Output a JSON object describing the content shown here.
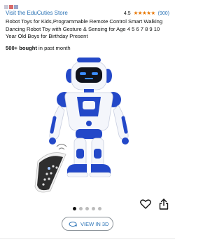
{
  "store": {
    "link_label": "Visit the EduCuties Store"
  },
  "rating": {
    "value": "4.5",
    "stars": "★★★★★",
    "count": "(900)",
    "score": 4.5
  },
  "product": {
    "title": "Robot Toys for Kids,Programmable Remote Control Smart Walking Dancing Robot Toy with Gesture & Sensing for Age 4 5 6 7 8 9 10 Year Old Boys for Birthday Present",
    "bought_bold": "500+ bought",
    "bought_rest": " in past month"
  },
  "carousel": {
    "dot_count": 5,
    "active_index": 0
  },
  "actions": {
    "view3d_label": "VIEW IN 3D"
  },
  "colors": {
    "link": "#2a72b5",
    "star": "#e77600",
    "robot_blue": "#2348c8"
  }
}
